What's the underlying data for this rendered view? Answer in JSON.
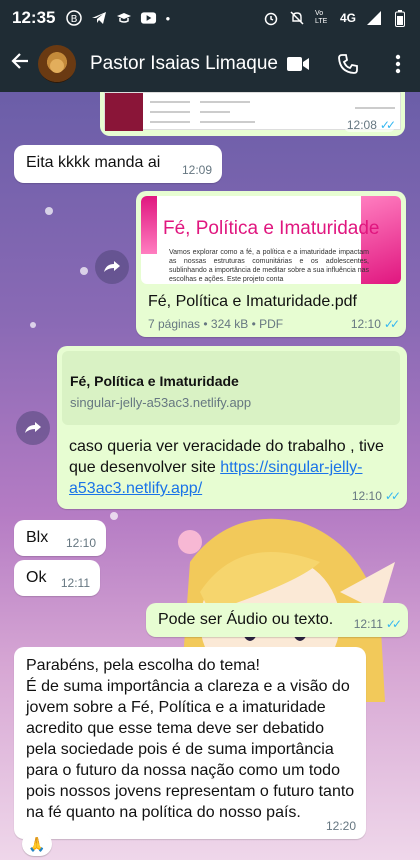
{
  "status_bar": {
    "time": "12:35",
    "network": "4G",
    "volte": "Vo LTE"
  },
  "header": {
    "contact_name": "Pastor Isaias Limaque"
  },
  "messages": {
    "preview_top": {
      "time": "12:08"
    },
    "m1": {
      "text": "Eita kkkk manda ai",
      "time": "12:09"
    },
    "pdf": {
      "thumb_title": "Fé, Política e Imaturidade",
      "thumb_body": "Vamos explorar como a fé, a política e a imaturidade impactam as nossas estruturas comunitárias e os adolescentes, sublinhando a importância de meditar sobre a sua influência nas escolhas e ações. Este projeto conta",
      "file_name": "Fé, Política e Imaturidade.pdf",
      "file_info": "7 páginas • 324 kB • PDF",
      "time": "12:10"
    },
    "link": {
      "title": "Fé, Política e Imaturidade",
      "domain": "singular-jelly-a53ac3.netlify.app",
      "text": "caso queria ver veracidade do trabalho , tive que desenvolver site ",
      "url": "https://singular-jelly-a53ac3.netlify.app/",
      "time": "12:10"
    },
    "m2": {
      "text": "Blx",
      "time": "12:10"
    },
    "m3": {
      "text": "Ok",
      "time": "12:11"
    },
    "m4": {
      "text": "Pode ser Áudio ou texto.",
      "time": "12:11"
    },
    "m5": {
      "text": "Parabéns, pela escolha do tema!\nÉ de suma importância a clareza e a visão do jovem sobre a Fé, Política e a imaturidade acredito que esse tema deve ser debatido pela sociedade pois é de suma importância para o futuro da nossa nação como um todo pois nossos jovens representam o futuro tanto na fé quanto na política do nosso país.",
      "time": "12:20"
    },
    "reaction": "🙏"
  },
  "colors": {
    "header_bg": "#1f2c34",
    "incoming_bg": "#ffffff",
    "outgoing_bg": "#e7fdd2",
    "read_ticks": "#34b7f1",
    "link": "#1a73e8"
  }
}
